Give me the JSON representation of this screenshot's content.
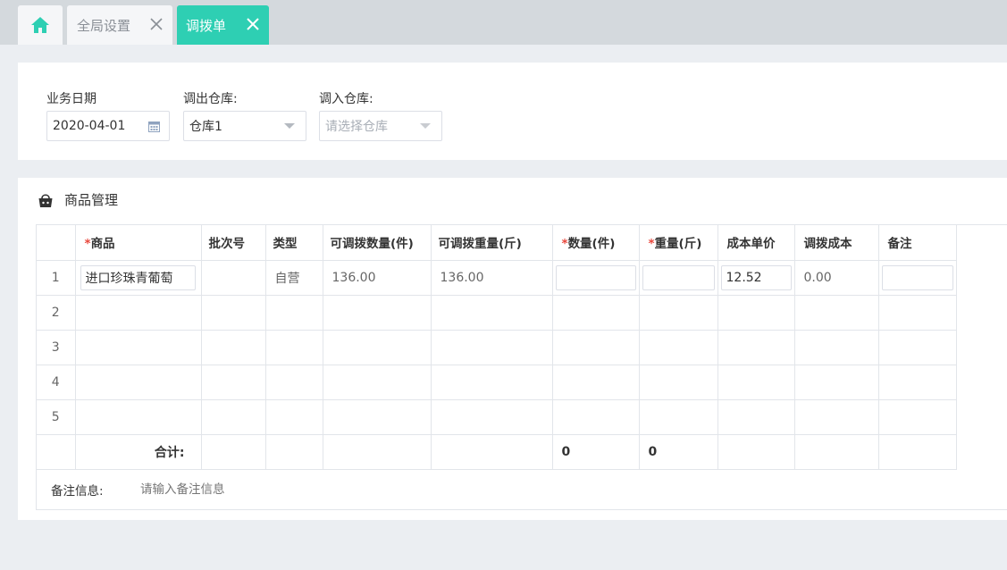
{
  "tabs": {
    "home_icon": "home-icon",
    "global_settings": "全局设置",
    "transfer": "调拨单"
  },
  "colors": {
    "accent": "#2ecfb3",
    "required": "#e8463b",
    "background": "#ebeef2"
  },
  "filter": {
    "date_label": "业务日期",
    "date_value": "2020-04-01",
    "out_label": "调出仓库:",
    "out_value": "仓库1",
    "in_label": "调入仓库:",
    "in_placeholder": "请选择仓库"
  },
  "goods": {
    "title": "商品管理",
    "columns": {
      "goods": "商品",
      "batch": "批次号",
      "type": "类型",
      "avail_qty": "可调拨数量(件)",
      "avail_weight": "可调拨重量(斤)",
      "qty": "数量(件)",
      "weight": "重量(斤)",
      "unit_cost": "成本单价",
      "transfer_cost": "调拨成本",
      "note": "备注"
    },
    "rows": [
      {
        "no": "1",
        "goods": "进口珍珠青葡萄",
        "batch": "",
        "type": "自营",
        "avail_qty": "136.00",
        "avail_weight": "136.00",
        "qty": "",
        "weight": "",
        "unit_cost": "12.52",
        "transfer_cost": "0.00",
        "note": ""
      },
      {
        "no": "2"
      },
      {
        "no": "3"
      },
      {
        "no": "4"
      },
      {
        "no": "5"
      }
    ],
    "total_label": "合计:",
    "total_qty": "0",
    "total_weight": "0"
  },
  "remark": {
    "label": "备注信息:",
    "placeholder": "请输入备注信息"
  }
}
